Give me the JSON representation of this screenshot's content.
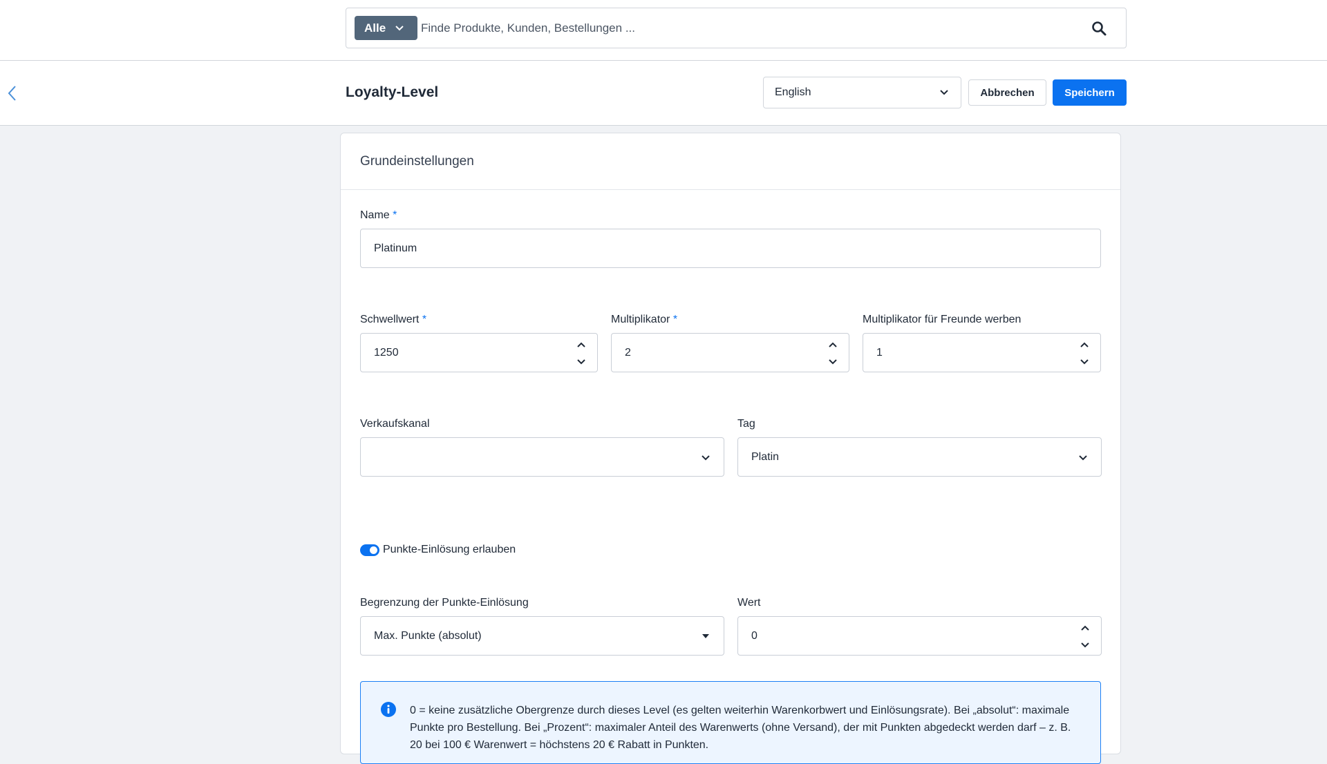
{
  "search": {
    "scope_label": "Alle",
    "placeholder": "Finde Produkte, Kunden, Bestellungen ..."
  },
  "header": {
    "title": "Loyalty-Level",
    "language": "English",
    "cancel_label": "Abbrechen",
    "save_label": "Speichern"
  },
  "card": {
    "title": "Grundeinstellungen",
    "required_marker": "*",
    "name": {
      "label": "Name",
      "value": "Platinum"
    },
    "threshold": {
      "label": "Schwellwert",
      "value": "1250"
    },
    "multiplier": {
      "label": "Multiplikator",
      "value": "2"
    },
    "referral_multiplier": {
      "label": "Multiplikator für Freunde werben",
      "value": "1"
    },
    "sales_channel": {
      "label": "Verkaufskanal",
      "value": ""
    },
    "tag": {
      "label": "Tag",
      "value": "Platin"
    },
    "redemption_toggle": {
      "label": "Punkte-Einlösung erlauben",
      "checked": true
    },
    "redemption_limit": {
      "label": "Begrenzung der Punkte-Einlösung",
      "value": "Max. Punkte (absolut)"
    },
    "value_field": {
      "label": "Wert",
      "value": "0"
    },
    "info_text": "0 = keine zusätzliche Obergrenze durch dieses Level (es gelten weiterhin Warenkorbwert und Einlösungsrate). Bei „absolut“: maximale Punkte pro Bestellung. Bei „Prozent“: maximaler Anteil des Warenwerts (ohne Versand), der mit Punkten abgedeckt werden darf – z. B. 20 bei 100 € Warenwert = höchstens 20 € Rabatt in Punkten."
  },
  "colors": {
    "primary": "#0b72f0",
    "scope_button": "#52667a",
    "info_bg": "#edf5ff"
  },
  "icons": [
    "chevron-down-icon",
    "search-icon",
    "chevron-left-icon",
    "chevron-up-icon",
    "info-icon"
  ]
}
